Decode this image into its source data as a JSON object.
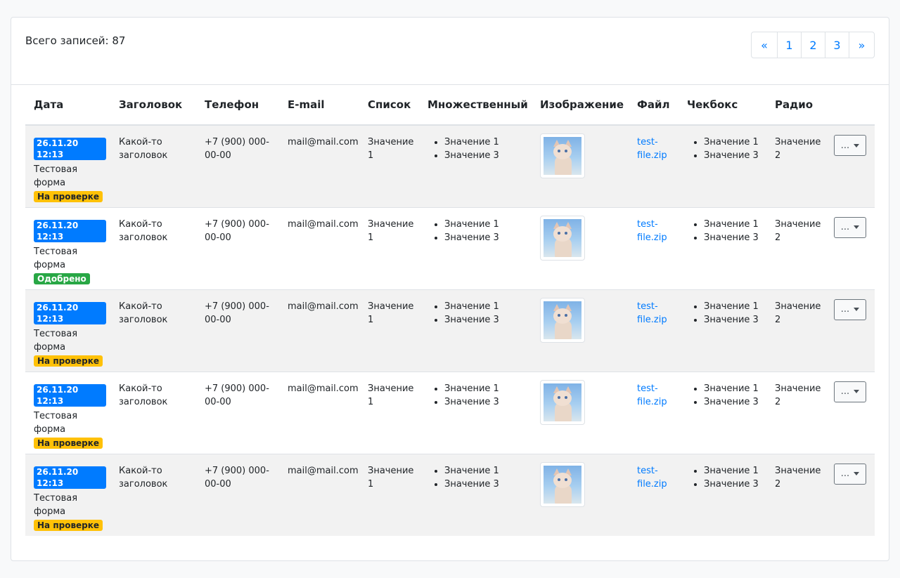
{
  "header": {
    "total_label": "Всего записей: 87"
  },
  "pagination": {
    "prev": "«",
    "pages": [
      "1",
      "2",
      "3"
    ],
    "next": "»"
  },
  "table": {
    "columns": [
      "Дата",
      "Заголовок",
      "Телефон",
      "E-mail",
      "Список",
      "Множественный",
      "Изображение",
      "Файл",
      "Чекбокс",
      "Радио"
    ],
    "rows": [
      {
        "date": "26.11.20 12:13",
        "form": "Тестовая форма",
        "status": "На проверке",
        "status_type": "warning",
        "title": "Какой-то заголовок",
        "phone": "+7 (900) 000-00-00",
        "email": "mail@mail.com",
        "list": "Значение 1",
        "multiple": [
          "Значение 1",
          "Значение 3"
        ],
        "image_icon": "kitten-image",
        "file": "test-file.zip",
        "checkbox": [
          "Значение 1",
          "Значение 3"
        ],
        "radio": "Значение 2",
        "action": "..."
      },
      {
        "date": "26.11.20 12:13",
        "form": "Тестовая форма",
        "status": "Одобрено",
        "status_type": "success",
        "title": "Какой-то заголовок",
        "phone": "+7 (900) 000-00-00",
        "email": "mail@mail.com",
        "list": "Значение 1",
        "multiple": [
          "Значение 1",
          "Значение 3"
        ],
        "image_icon": "kitten-image",
        "file": "test-file.zip",
        "checkbox": [
          "Значение 1",
          "Значение 3"
        ],
        "radio": "Значение 2",
        "action": "..."
      },
      {
        "date": "26.11.20 12:13",
        "form": "Тестовая форма",
        "status": "На проверке",
        "status_type": "warning",
        "title": "Какой-то заголовок",
        "phone": "+7 (900) 000-00-00",
        "email": "mail@mail.com",
        "list": "Значение 1",
        "multiple": [
          "Значение 1",
          "Значение 3"
        ],
        "image_icon": "kitten-image",
        "file": "test-file.zip",
        "checkbox": [
          "Значение 1",
          "Значение 3"
        ],
        "radio": "Значение 2",
        "action": "..."
      },
      {
        "date": "26.11.20 12:13",
        "form": "Тестовая форма",
        "status": "На проверке",
        "status_type": "warning",
        "title": "Какой-то заголовок",
        "phone": "+7 (900) 000-00-00",
        "email": "mail@mail.com",
        "list": "Значение 1",
        "multiple": [
          "Значение 1",
          "Значение 3"
        ],
        "image_icon": "kitten-image",
        "file": "test-file.zip",
        "checkbox": [
          "Значение 1",
          "Значение 3"
        ],
        "radio": "Значение 2",
        "action": "..."
      },
      {
        "date": "26.11.20 12:13",
        "form": "Тестовая форма",
        "status": "На проверке",
        "status_type": "warning",
        "title": "Какой-то заголовок",
        "phone": "+7 (900) 000-00-00",
        "email": "mail@mail.com",
        "list": "Значение 1",
        "multiple": [
          "Значение 1",
          "Значение 3"
        ],
        "image_icon": "kitten-image",
        "file": "test-file.zip",
        "checkbox": [
          "Значение 1",
          "Значение 3"
        ],
        "radio": "Значение 2",
        "action": "..."
      }
    ]
  },
  "colors": {
    "primary": "#007bff",
    "warning": "#ffc107",
    "success": "#28a745",
    "stripe": "#f2f2f2",
    "border": "#dee2e6"
  }
}
